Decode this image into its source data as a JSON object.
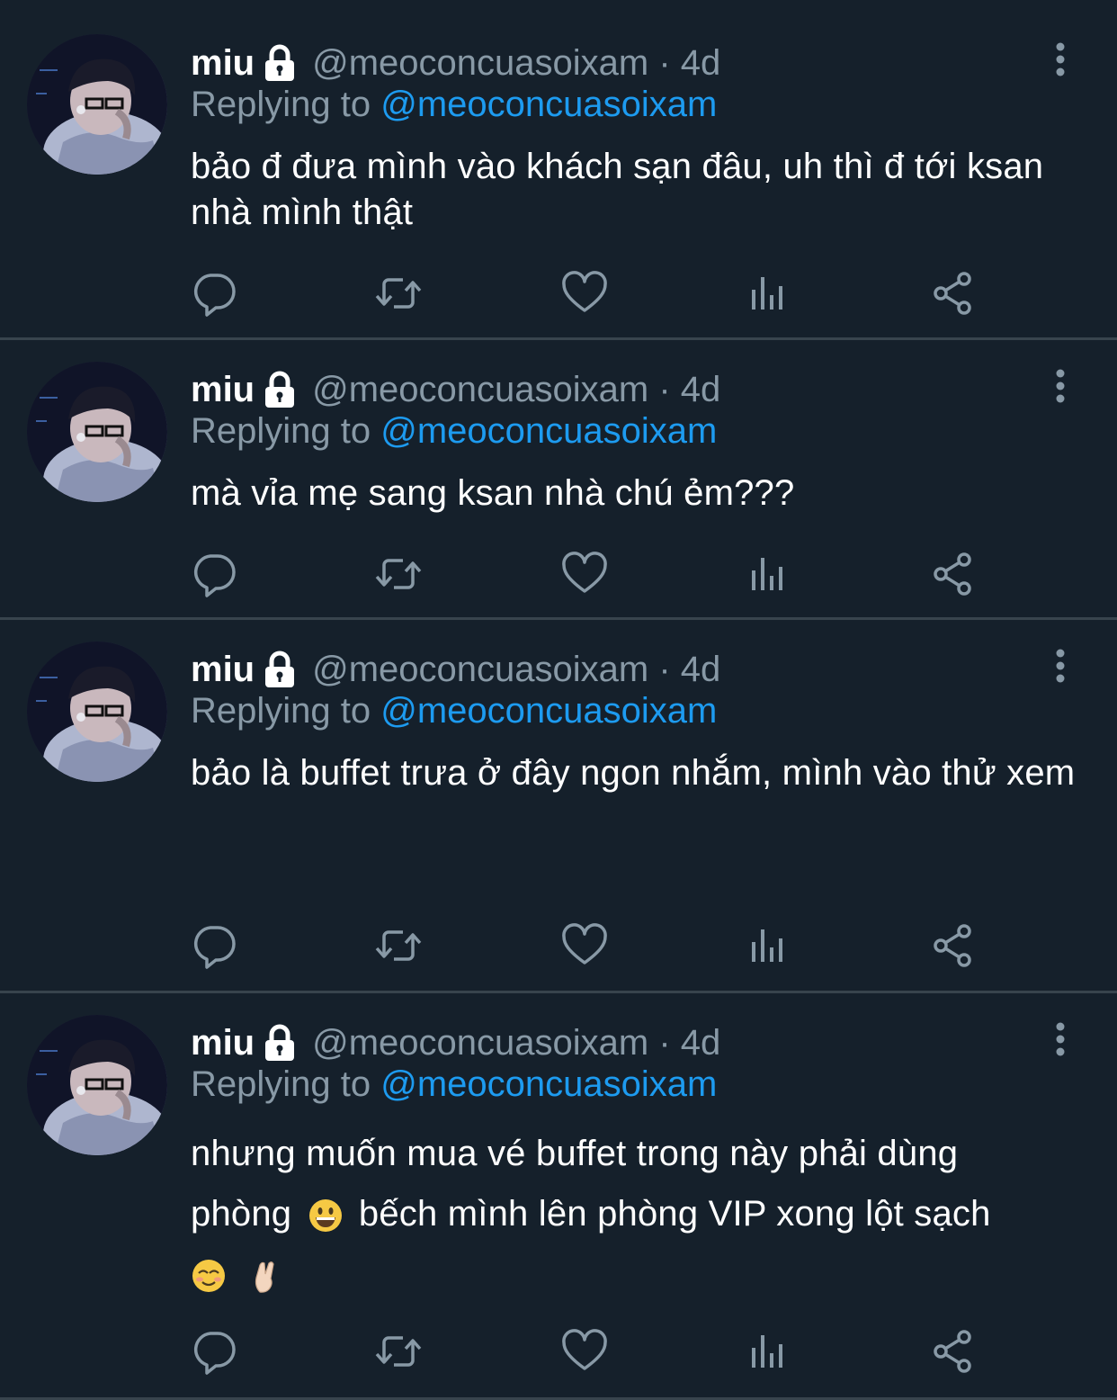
{
  "colors": {
    "background": "#15202b",
    "divider": "#38444d",
    "secondary_text": "#8899a6",
    "link": "#1d9bf0"
  },
  "tweets": [
    {
      "name": "miu",
      "handle_time": "@meoconcuasoixam · 4d",
      "reply_prefix": "Replying to",
      "reply_to": "@meoconcuasoixam",
      "text": "bảo đ đưa mình vào khách sạn đâu, uh thì đ tới ksan nhà mình thật"
    },
    {
      "name": "miu",
      "handle_time": "@meoconcuasoixam · 4d",
      "reply_prefix": "Replying to",
      "reply_to": "@meoconcuasoixam",
      "text": "mà vỉa mẹ sang ksan nhà chú ẻm???"
    },
    {
      "name": "miu",
      "handle_time": "@meoconcuasoixam · 4d",
      "reply_prefix": "Replying to",
      "reply_to": "@meoconcuasoixam",
      "text": "bảo là buffet trưa ở đây ngon nhắm, mình vào thử xem"
    },
    {
      "name": "miu",
      "handle_time": "@meoconcuasoixam · 4d",
      "reply_prefix": "Replying to",
      "reply_to": "@meoconcuasoixam",
      "text_line1": "nhưng muốn mua vé buffet trong này phải dùng",
      "text_line2a": "phòng",
      "text_line2b": "bếch mình lên phòng VIP xong lột sạch",
      "emojis": [
        "grinning-face-emoji",
        "smiling-face-emoji",
        "crossed-fingers-emoji"
      ]
    }
  ],
  "action_icons": [
    "reply-icon",
    "retweet-icon",
    "like-icon",
    "analytics-icon",
    "share-icon"
  ]
}
